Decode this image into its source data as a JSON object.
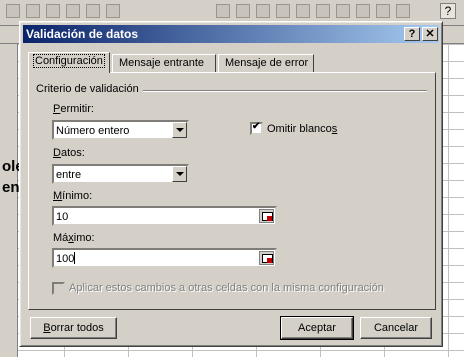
{
  "dialog": {
    "title": "Validación de datos",
    "help_button": "?",
    "close_button": "✕"
  },
  "tabs": [
    {
      "label": "Configuración"
    },
    {
      "label": "Mensaje entrante"
    },
    {
      "label": "Mensaje de error"
    }
  ],
  "criteria": {
    "group_title": "Criterio de validación",
    "permitir_label_underline": "P",
    "permitir_label_rest": "ermitir:",
    "permitir_value": "Número entero",
    "datos_label_underline": "D",
    "datos_label_rest": "atos:",
    "datos_value": "entre",
    "minimo_label_underline": "M",
    "minimo_label_rest": "ínimo:",
    "minimo_value": "10",
    "maximo_label_prefix": "Má",
    "maximo_label_underline": "x",
    "maximo_label_rest": "imo:",
    "maximo_value": "100",
    "omitir_label_prefix": "Omitir blanco",
    "omitir_label_underline": "s",
    "omitir_checked": true,
    "aplicar_label": "Aplicar estos cambios a otras celdas con la misma configuración",
    "aplicar_checked": false
  },
  "buttons": {
    "borrar_underline": "B",
    "borrar_rest": "orrar todos",
    "aceptar": "Aceptar",
    "cancelar": "Cancelar"
  },
  "background": {
    "cell_text_1": "ole",
    "cell_text_2": "en"
  },
  "icons": [
    "help-icon",
    "close-icon",
    "chevron-down-icon",
    "cell-range-picker-icon",
    "checkmark-icon"
  ],
  "colors": {
    "titlebar_start": "#0a246a",
    "titlebar_end": "#a6caf0",
    "dialog_face": "#d4d0c8"
  }
}
